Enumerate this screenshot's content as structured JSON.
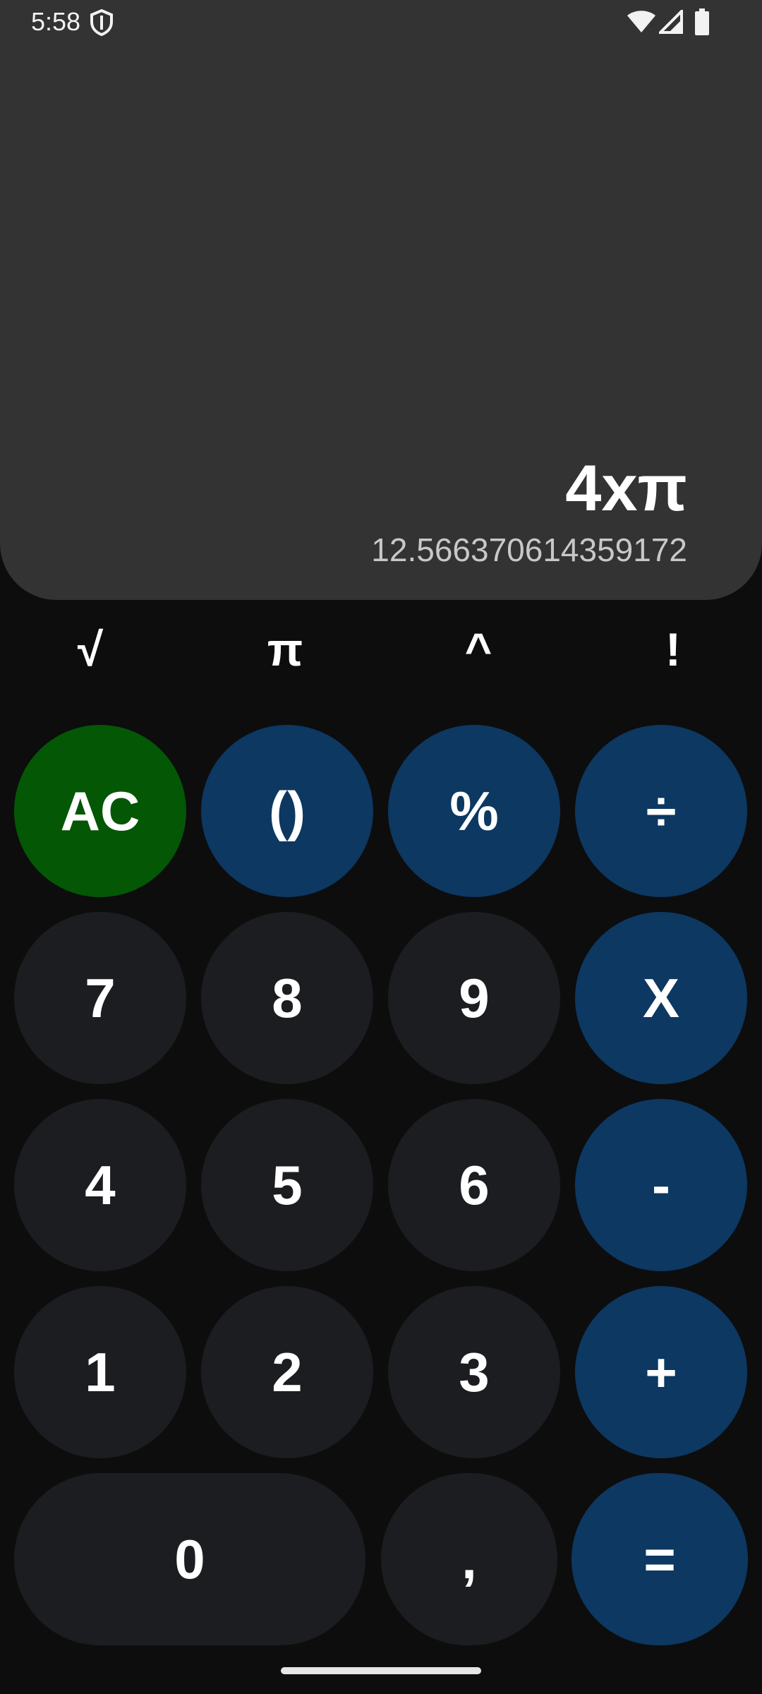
{
  "status_bar": {
    "time": "5:58",
    "icons": [
      "shield-icon",
      "wifi-icon",
      "signal-icon",
      "battery-icon"
    ]
  },
  "display": {
    "expression": "4xπ",
    "result": "12.566370614359172"
  },
  "scientific_row": [
    "√",
    "π",
    "^",
    "!"
  ],
  "keypad": {
    "clear": "AC",
    "parentheses": "()",
    "percent": "%",
    "divide": "÷",
    "seven": "7",
    "eight": "8",
    "nine": "9",
    "multiply": "X",
    "four": "4",
    "five": "5",
    "six": "6",
    "minus": "-",
    "one": "1",
    "two": "2",
    "three": "3",
    "plus": "+",
    "zero": "0",
    "comma": ",",
    "equals": "="
  },
  "colors": {
    "background": "#0d0d0d",
    "display_background": "#333333",
    "number_key": "#1c1d20",
    "operator_key": "#0c3862",
    "clear_key": "#045705"
  }
}
